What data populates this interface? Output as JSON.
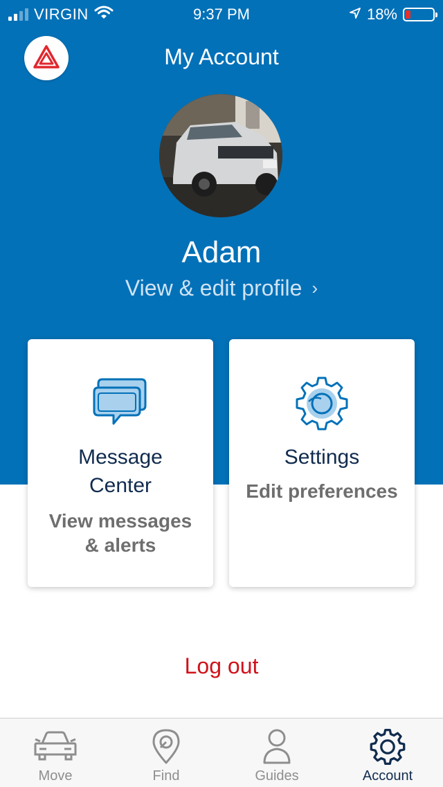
{
  "status_bar": {
    "carrier": "VIRGIN",
    "time": "9:37 PM",
    "battery": "18%",
    "battery_level": 0.18,
    "icons": [
      "signal-icon",
      "wifi-icon",
      "location-arrow-icon",
      "battery-icon"
    ]
  },
  "header": {
    "title": "My Account",
    "hazard_icon": "hazard-triangle-icon"
  },
  "profile": {
    "name": "Adam",
    "link_text": "View & edit profile",
    "link_chevron": "›"
  },
  "cards": [
    {
      "icon": "message-bubbles-icon",
      "title_line1": "Message",
      "title_line2": "Center",
      "sub_line1": "View messages",
      "sub_line2": "& alerts"
    },
    {
      "icon": "gear-icon",
      "title_line1": "Settings",
      "sub_line1": "Edit preferences"
    }
  ],
  "logout_label": "Log out",
  "tabs": [
    {
      "label": "Move",
      "icon": "car-icon",
      "active": false
    },
    {
      "label": "Find",
      "icon": "map-pin-icon",
      "active": false
    },
    {
      "label": "Guides",
      "icon": "person-icon",
      "active": false
    },
    {
      "label": "Account",
      "icon": "gear-icon",
      "active": true
    }
  ],
  "colors": {
    "primary_blue": "#0371b8",
    "dark_navy": "#102b4e",
    "logout_red": "#d0121a",
    "hazard_red": "#e1262d",
    "inactive_gray": "#8e8e8e"
  }
}
